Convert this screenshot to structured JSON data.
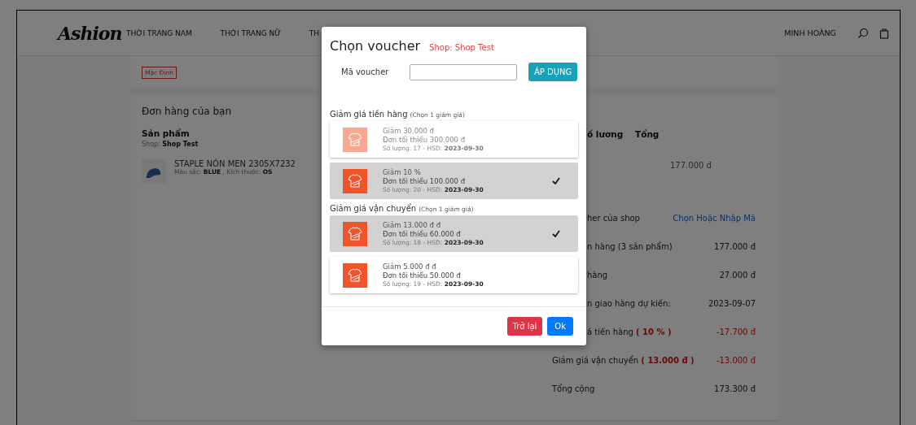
{
  "header": {
    "logo": "Ashion",
    "nav": [
      "THỜI TRANG NAM",
      "THỜI TRANG NỮ",
      "TH"
    ],
    "user": "MINH HOÀNG"
  },
  "address": {
    "tag": "Mặc Định"
  },
  "order": {
    "title": "Đơn hàng của bạn",
    "columns": [
      {
        "label": "Sản phẩm",
        "behind_dialog": false
      },
      {
        "label": "ố lương",
        "behind_dialog": true
      },
      {
        "label": "Tổng",
        "behind_dialog": false
      }
    ],
    "shop": "Shop: **Shop Test**",
    "product": {
      "name": "STAPLE NÓN MEN 2305X7232",
      "details": "Màu sắc: **BLUE** , Kích thước: **OS**",
      "total": "177.000 đ"
    },
    "summary": [
      {
        "label": "her của shop",
        "value": "Chọn Hoặc Nhập Mã",
        "kind": "link",
        "behind_dialog": true
      },
      {
        "label": "n hàng (3 sản phẩm)",
        "value": "177.000 đ",
        "kind": "amount",
        "behind_dialog": true
      },
      {
        "label": "hàng",
        "value": "27.000 đ",
        "kind": "amount",
        "behind_dialog": true
      },
      {
        "label": "n giao hàng dự kiến:",
        "value": "2023-09-07",
        "kind": "amount",
        "behind_dialog": true
      },
      {
        "label": "á tiến hàng **( 10 % )**",
        "value": "-17.700 đ",
        "kind": "discount",
        "behind_dialog": true
      },
      {
        "label": "Giảm giá vận chuyển **( 13.000 đ )**",
        "value": "-13.000 đ",
        "kind": "discount",
        "behind_dialog": false
      },
      {
        "label": "Tổng cộng",
        "value": "173.300 đ",
        "kind": "amount",
        "behind_dialog": false
      }
    ]
  },
  "dialog": {
    "title": "Chọn voucher",
    "shop": "Shop: Shop Test",
    "code_label": "Mã voucher",
    "apply_button": "ÁP DỤNG",
    "sections": [
      {
        "title": "Giảm giá tiền hàng",
        "hint": "(Chọn 1 giảm giá)",
        "vouchers": [
          {
            "title": "Giảm 30.000 đ",
            "min_order": "Đơn tối thiểu 300.000 đ",
            "stock": "Số lượng: 17 - HSD: **2023-09-30**",
            "selected": false,
            "disabled": true
          },
          {
            "title": "Giảm 10 %",
            "min_order": "Đơn tối thiểu 100.000 đ",
            "stock": "Số lượng: 20 - HSD: **2023-09-30**",
            "selected": true,
            "disabled": false
          }
        ]
      },
      {
        "title": "Giảm giá vận chuyển",
        "hint": "(Chọn 1 giảm giá)",
        "vouchers": [
          {
            "title": "Giảm 13.000 đ đ",
            "min_order": "Đơn tối thiểu 60.000 đ",
            "stock": "Số lượng: 18 - HSD: **2023-09-30**",
            "selected": true,
            "disabled": false
          },
          {
            "title": "Giảm 5.000 đ đ",
            "min_order": "Đơn tối thiểu 50.000 đ",
            "stock": "Số lượng: 19 - HSD: **2023-09-30**",
            "selected": false,
            "disabled": false
          }
        ]
      }
    ],
    "buttons": [
      {
        "label": "Trở lại",
        "kind": "back"
      },
      {
        "label": "Ok",
        "kind": "ok"
      }
    ]
  }
}
